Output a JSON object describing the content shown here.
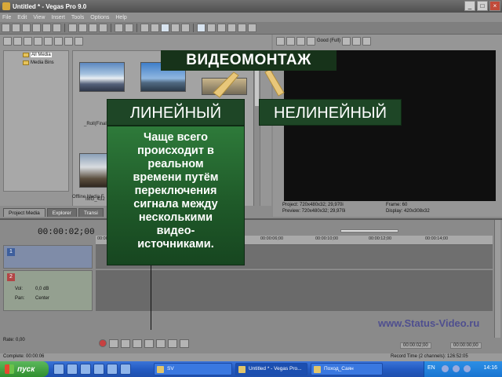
{
  "window": {
    "title": "Untitled * - Vegas Pro 9.0",
    "buttons": {
      "minimize": "_",
      "maximize": "□",
      "close": "×"
    }
  },
  "menu": [
    "File",
    "Edit",
    "View",
    "Insert",
    "Tools",
    "Options",
    "Help"
  ],
  "explorer": {
    "tree": [
      {
        "label": "All Media",
        "selected": true
      },
      {
        "label": "Media Bins",
        "selected": false
      }
    ],
    "media": [
      {
        "label": "_Roll(Final"
      },
      {
        "label": "IMG_432"
      }
    ],
    "offline_label": "Offline Media F",
    "tabs": [
      "Project Media",
      "Explorer",
      "Transi"
    ]
  },
  "preview": {
    "quality": "Good (Full)",
    "info": {
      "project": "Project:  720x480x32; 29,970i",
      "preview": "Preview: 720x480x32; 29,970i",
      "frame": "Frame:      60",
      "display": "Display:   420x308x32"
    }
  },
  "timeline": {
    "timecode": "00:00:02;00",
    "ruler": [
      "00:00:00;00",
      "00:00:06;00",
      "00:00:10;00",
      "00:00:12;00",
      "00:00:14;00"
    ],
    "video_track_number": "1",
    "audio_track_number": "2",
    "vol_label": "Vol:",
    "vol_value": "0,0 dB",
    "pan_label": "Pan:",
    "pan_value": "Center",
    "rate": "Rate: 0,00",
    "time_right": "00:00:02;00",
    "time_right2": "00:00:00;00"
  },
  "watermark": "www.Status-Video.ru",
  "status": {
    "complete": "Complete: 00:00:06",
    "record_time": "Record Time (2 channels): 126:52:05"
  },
  "taskbar": {
    "start": "пуск",
    "tasks": [
      {
        "label": "SV",
        "active": false
      },
      {
        "label": "Untitled * - Vegas Pro...",
        "active": true
      },
      {
        "label": "Поход_Саян",
        "active": false
      }
    ],
    "lang": "EN",
    "clock": "14:16"
  },
  "overlay": {
    "title": "ВИДЕОМОНТАЖ",
    "linear": "ЛИНЕЙНЫЙ",
    "nonlinear": "НЕЛИНЕЙНЫЙ",
    "description_lines": [
      "Чаще всего",
      "происходит в",
      "реальном",
      "времени путём",
      "переключения",
      "сигнала между",
      "несколькими",
      "видео-",
      "источниками."
    ]
  },
  "colors": {
    "overlay_green": "#1e4626",
    "arrow": "#e8c77a",
    "watermark": "#4f4f8f"
  }
}
